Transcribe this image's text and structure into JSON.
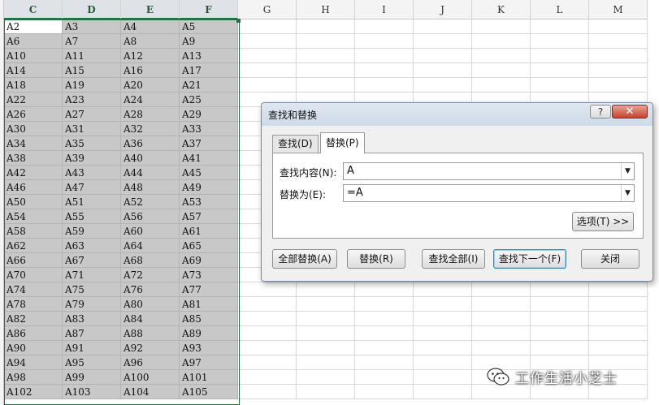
{
  "columns": [
    "C",
    "D",
    "E",
    "F",
    "G",
    "H",
    "I",
    "J",
    "K",
    "L",
    "M"
  ],
  "rows": [
    [
      "A2",
      "A3",
      "A4",
      "A5"
    ],
    [
      "A6",
      "A7",
      "A8",
      "A9"
    ],
    [
      "A10",
      "A11",
      "A12",
      "A13"
    ],
    [
      "A14",
      "A15",
      "A16",
      "A17"
    ],
    [
      "A18",
      "A19",
      "A20",
      "A21"
    ],
    [
      "A22",
      "A23",
      "A24",
      "A25"
    ],
    [
      "A26",
      "A27",
      "A28",
      "A29"
    ],
    [
      "A30",
      "A31",
      "A32",
      "A33"
    ],
    [
      "A34",
      "A35",
      "A36",
      "A37"
    ],
    [
      "A38",
      "A39",
      "A40",
      "A41"
    ],
    [
      "A42",
      "A43",
      "A44",
      "A45"
    ],
    [
      "A46",
      "A47",
      "A48",
      "A49"
    ],
    [
      "A50",
      "A51",
      "A52",
      "A53"
    ],
    [
      "A54",
      "A55",
      "A56",
      "A57"
    ],
    [
      "A58",
      "A59",
      "A60",
      "A61"
    ],
    [
      "A62",
      "A63",
      "A64",
      "A65"
    ],
    [
      "A66",
      "A67",
      "A68",
      "A69"
    ],
    [
      "A70",
      "A71",
      "A72",
      "A73"
    ],
    [
      "A74",
      "A75",
      "A76",
      "A77"
    ],
    [
      "A78",
      "A79",
      "A80",
      "A81"
    ],
    [
      "A82",
      "A83",
      "A84",
      "A85"
    ],
    [
      "A86",
      "A87",
      "A88",
      "A89"
    ],
    [
      "A90",
      "A91",
      "A92",
      "A93"
    ],
    [
      "A94",
      "A95",
      "A96",
      "A97"
    ],
    [
      "A98",
      "A99",
      "A100",
      "A101"
    ],
    [
      "A102",
      "A103",
      "A104",
      "A105"
    ]
  ],
  "dialog": {
    "title": "查找和替换",
    "help": "?",
    "close": "✕",
    "tabs": [
      "查找(D)",
      "替换(P)"
    ],
    "find_label": "查找内容(N):",
    "find_value": "A",
    "replace_label": "替换为(E):",
    "replace_value": "=A",
    "options_button": "选项(T) >>",
    "buttons": {
      "replace_all": "全部替换(A)",
      "replace": "替换(R)",
      "find_all": "查找全部(I)",
      "find_next": "查找下一个(F)",
      "close": "关闭"
    }
  },
  "watermark": "工作生活小芝士",
  "colors": {
    "selection": "#c8c8c8",
    "accent": "#217346"
  }
}
